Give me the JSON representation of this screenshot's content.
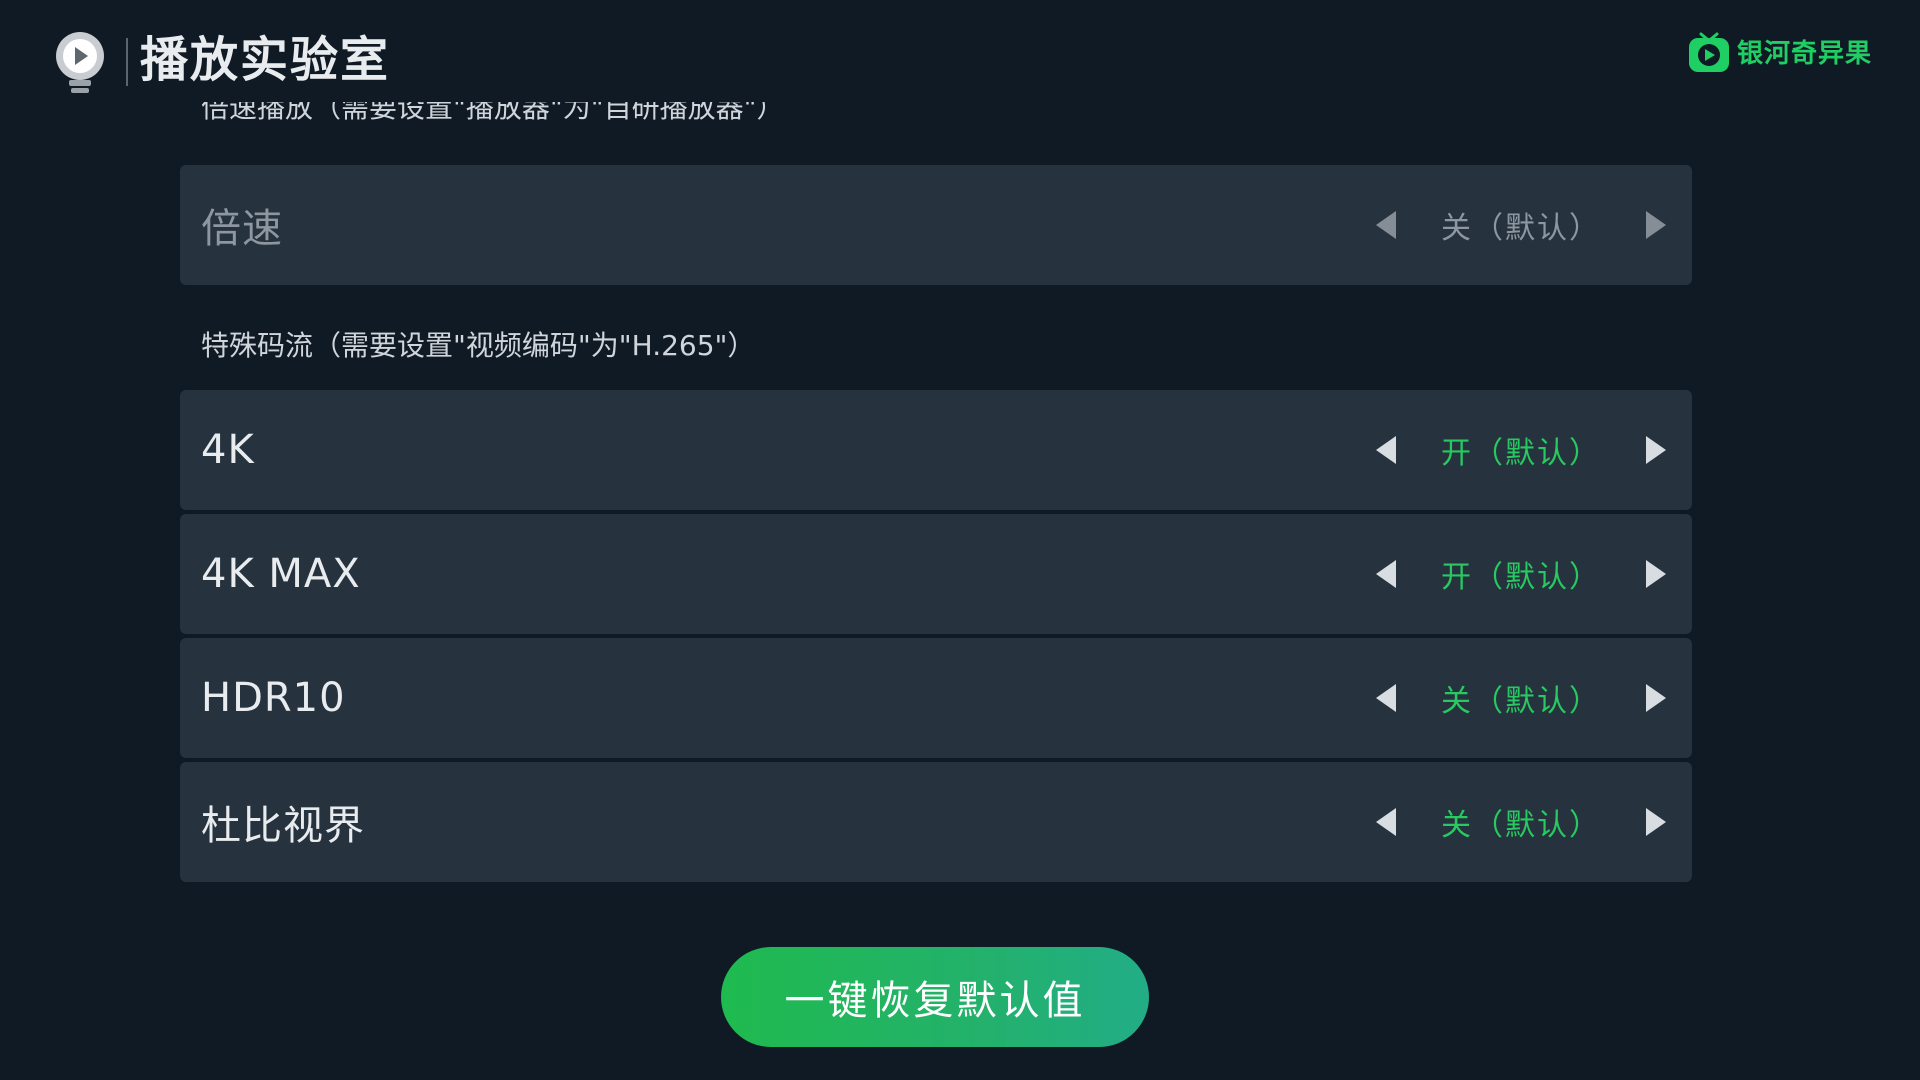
{
  "header": {
    "title": "播放实验室",
    "brand_name": "银河奇异果"
  },
  "sections": [
    {
      "label": "倍速播放（需要设置\"播放器\"为\"自研播放器\"）",
      "rows": [
        {
          "label": "倍速",
          "value": "关（默认）",
          "enabled": false
        }
      ]
    },
    {
      "label": "特殊码流（需要设置\"视频编码\"为\"H.265\"）",
      "rows": [
        {
          "label": "4K",
          "value": "开（默认）",
          "enabled": true
        },
        {
          "label": "4K MAX",
          "value": "开（默认）",
          "enabled": true
        },
        {
          "label": "HDR10",
          "value": "关（默认）",
          "enabled": true
        },
        {
          "label": "杜比视界",
          "value": "关（默认）",
          "enabled": true
        }
      ]
    }
  ],
  "reset_button": {
    "label": "一键恢复默认值"
  },
  "colors": {
    "background": "#101a25",
    "row": "#26323e",
    "accent_green": "#27c960",
    "disabled_text": "#8e979f"
  },
  "icons": {
    "header": "lab-bulb-play-icon",
    "brand": "iqiyi-tv-logo-icon",
    "prev": "triangle-left-icon",
    "next": "triangle-right-icon"
  }
}
